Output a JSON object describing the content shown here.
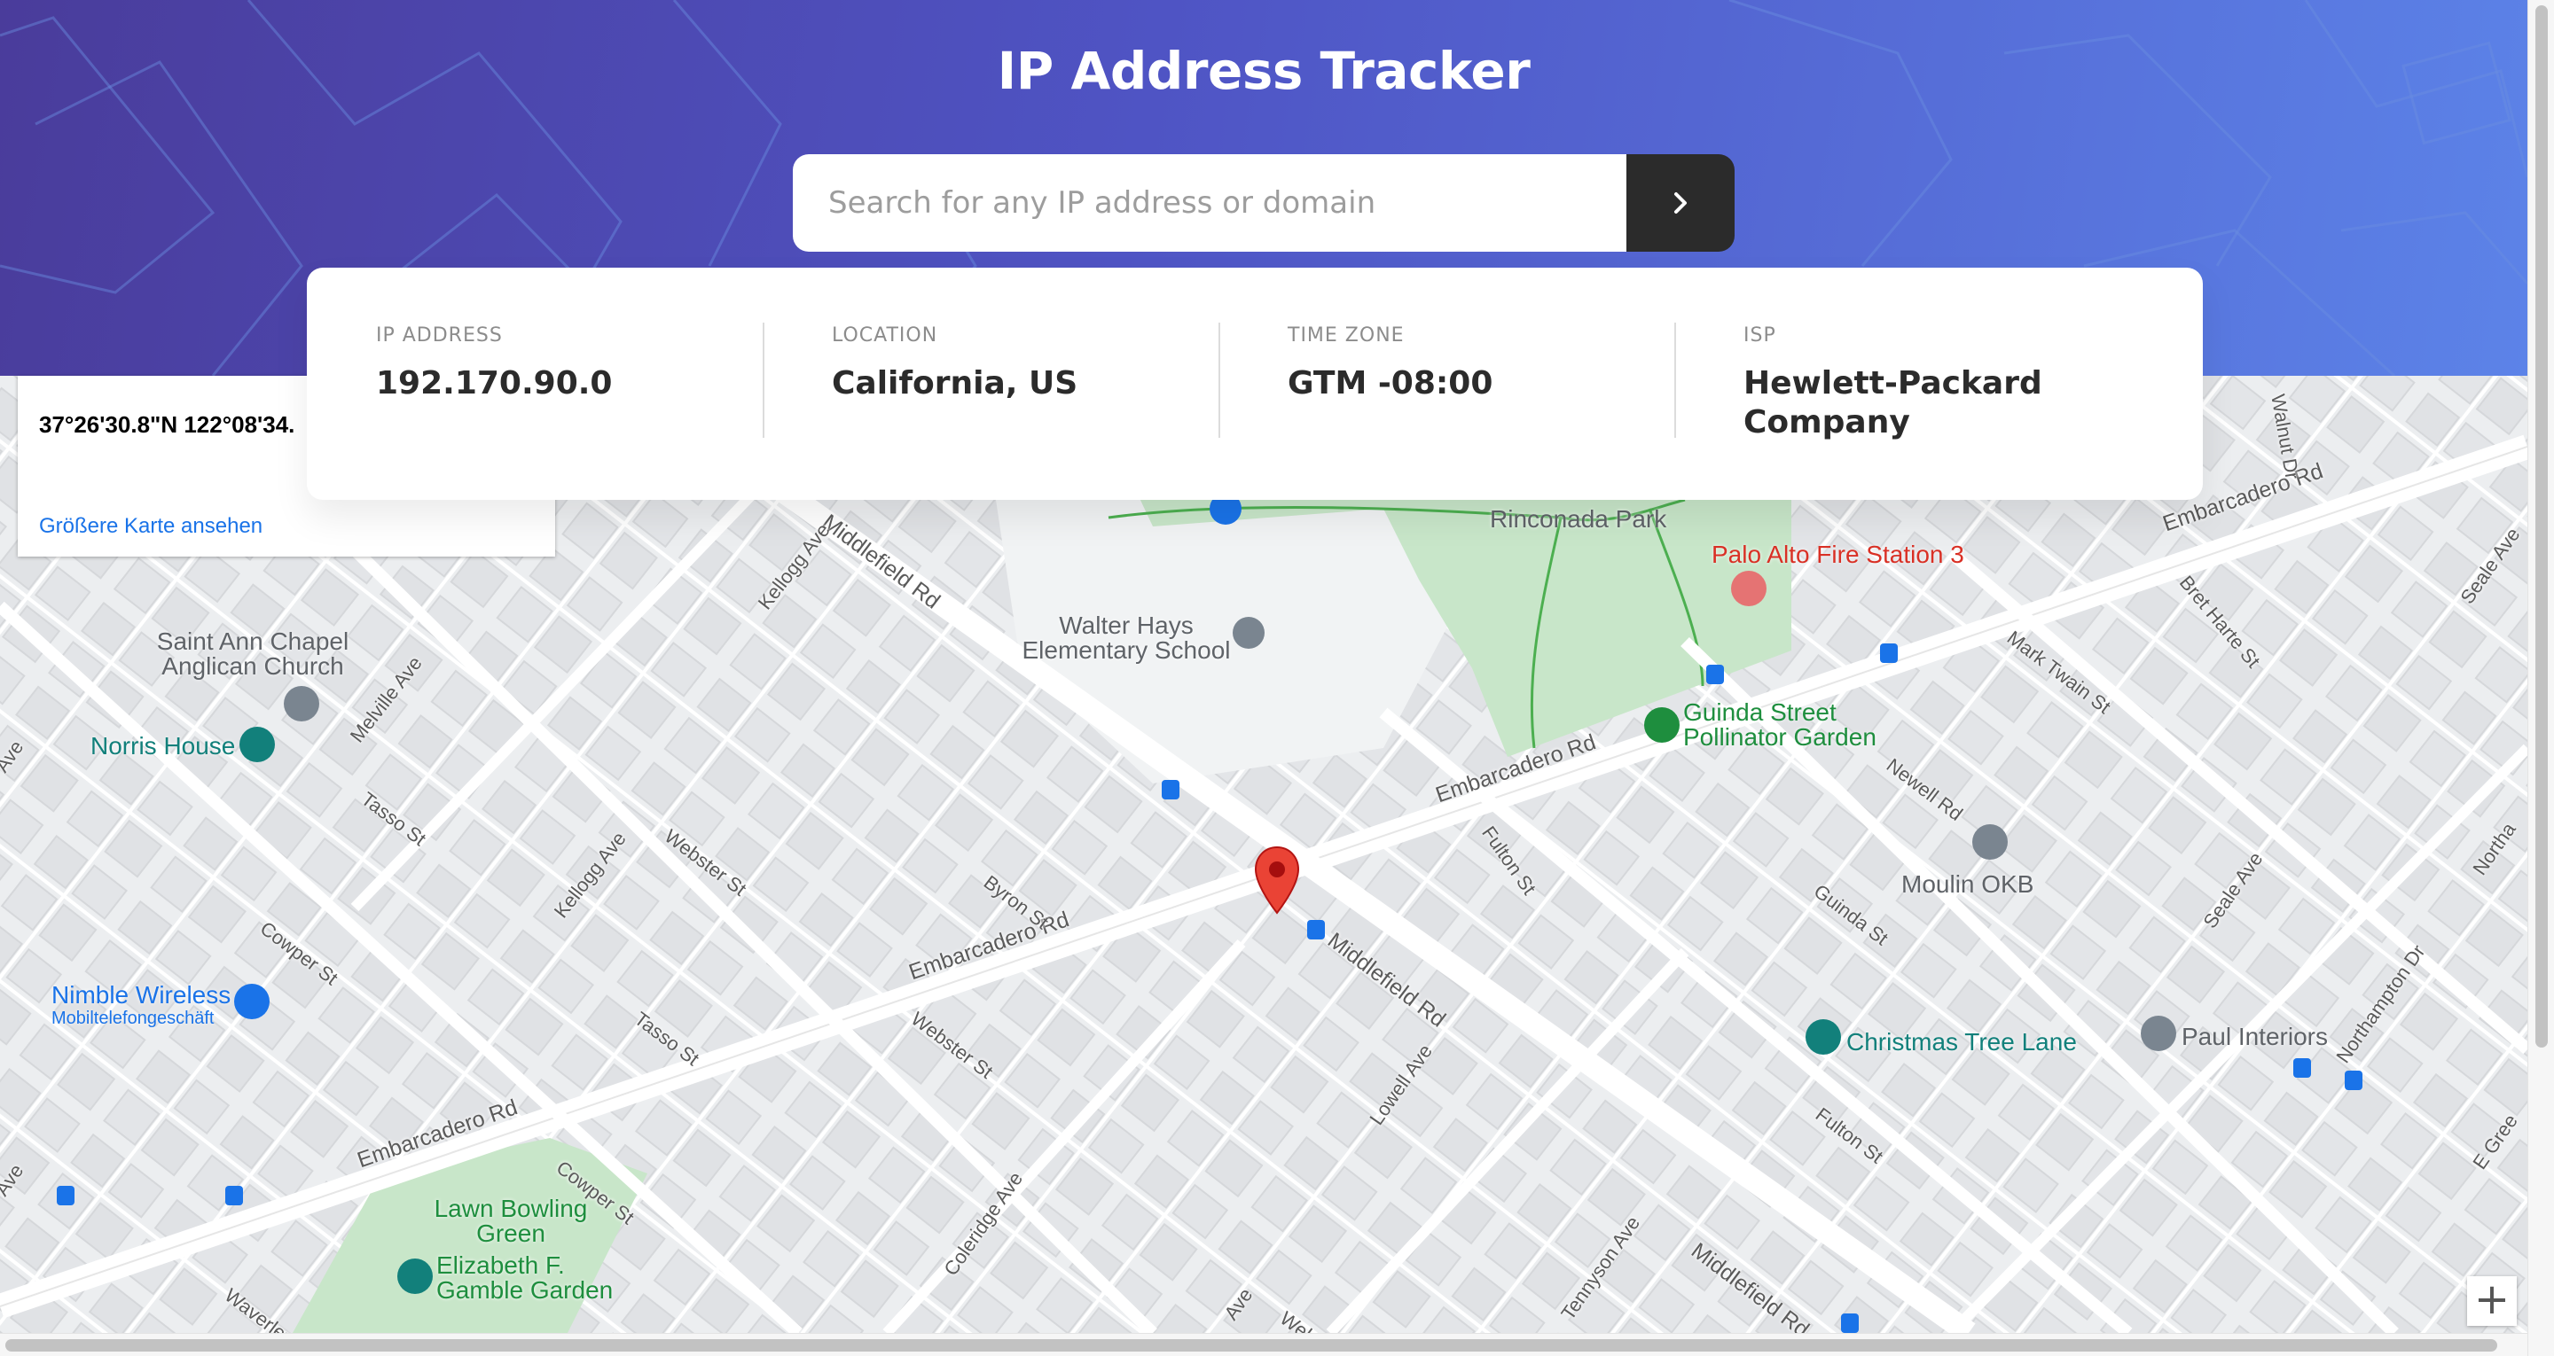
{
  "app": {
    "title": "IP Address Tracker"
  },
  "search": {
    "placeholder": "Search for any IP address or domain",
    "value": "",
    "button_icon": "chevron-right-icon"
  },
  "info": [
    {
      "label": "IP ADDRESS",
      "value": "192.170.90.0"
    },
    {
      "label": "LOCATION",
      "value": "California, US"
    },
    {
      "label": "TIME ZONE",
      "value": "GTM -08:00"
    },
    {
      "label": "ISP",
      "value": "Hewlett-Packard Company"
    }
  ],
  "map": {
    "coordinates": "37°26'30.8\"N 122°08'34.",
    "larger_map_link": "Größere Karte ansehen",
    "zoom_in_label": "+",
    "marker_icon": "map-pin-icon",
    "pois": {
      "rinconada_park": "Rinconada Park",
      "fire_station": "Palo Alto Fire Station 3",
      "walter_hays": "Walter Hays Elementary School",
      "saint_ann": "Saint Ann Chapel Anglican Church",
      "norris_house": "Norris House",
      "guinda_garden": "Guinda Street Pollinator Garden",
      "moulin": "Moulin OKB",
      "nimble_wireless": "Nimble Wireless",
      "nimble_wireless_sub": "Mobiltelefongeschäft",
      "christmas_tree_lane": "Christmas Tree Lane",
      "paul_interiors": "Paul Interiors",
      "lawn_bowling": "Lawn Bowling Green",
      "gamble_garden": "Elizabeth F. Gamble Garden"
    },
    "streets": {
      "middlefield_rd": "Middlefield Rd",
      "embarcadero_rd": "Embarcadero Rd",
      "kellogg_ave": "Kellogg Ave",
      "melville_ave": "Melville Ave",
      "tasso_st": "Tasso St",
      "webster_st": "Webster St",
      "byron_st": "Byron St",
      "cowper_st": "Cowper St",
      "fulton_st": "Fulton St",
      "guinda_st": "Guinda St",
      "newell_rd": "Newell Rd",
      "mark_twain_st": "Mark Twain St",
      "bret_harte_st": "Bret Harte St",
      "walnut_dr": "Walnut Dr",
      "seale_ave": "Seale Ave",
      "northampton_dr": "Northampton Dr",
      "northa": "Northa",
      "e_green": "E Gree",
      "lowell_ave": "Lowell Ave",
      "coleridge_ave": "Coleridge Ave",
      "tennyson_ave": "Tennyson Ave",
      "waverley": "Waverley",
      "ave": "Ave",
      "webs": "Webs"
    }
  },
  "colors": {
    "header_start": "#4a3c9b",
    "header_end": "#5c83e8",
    "button": "#2b2b2b",
    "park": "#c8e6c9",
    "marker": "#ea4335"
  }
}
